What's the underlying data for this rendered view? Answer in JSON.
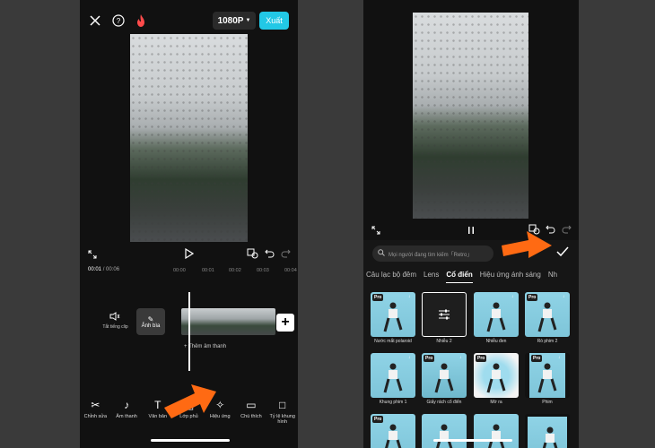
{
  "left": {
    "resolution": "1080P",
    "export_label": "Xuất",
    "time_current": "00:01",
    "time_total": "00:06",
    "ticks": [
      "00:00",
      "00:01",
      "00:02",
      "00:03",
      "00:04"
    ],
    "mute_label": "Tắt tiếng clip",
    "cover_label": "Ảnh bìa",
    "add_audio": "+ Thêm âm thanh",
    "tools": [
      {
        "icon": "scissors-icon",
        "label": "Chỉnh sửa"
      },
      {
        "icon": "music-note-icon",
        "label": "Âm thanh"
      },
      {
        "icon": "text-icon",
        "label": "Văn bản"
      },
      {
        "icon": "overlay-icon",
        "label": "Lớp phủ"
      },
      {
        "icon": "sparkle-icon",
        "label": "Hiệu ứng"
      },
      {
        "icon": "caption-icon",
        "label": "Chú thích"
      },
      {
        "icon": "aspect-ratio-icon",
        "label": "Tỷ lệ khung hình"
      }
    ]
  },
  "right": {
    "search_placeholder": "Mọi người đang tìm kiếm「Retro」",
    "tabs": [
      {
        "label": "Câu lạc bộ đêm",
        "active": false
      },
      {
        "label": "Lens",
        "active": false
      },
      {
        "label": "Cổ điển",
        "active": true
      },
      {
        "label": "Hiệu ứng ánh sáng",
        "active": false
      },
      {
        "label": "Nh",
        "active": false
      }
    ],
    "effects": [
      {
        "label": "Nước mắt polaroid",
        "pro": "Pro"
      },
      {
        "label": "Nhiễu 2",
        "pro": ""
      },
      {
        "label": "Nhiễu đen",
        "pro": ""
      },
      {
        "label": "Rò phim 2",
        "pro": "Pro"
      },
      {
        "label": "Khung phim 1",
        "pro": ""
      },
      {
        "label": "Giấy rách cổ điển",
        "pro": "Pro"
      },
      {
        "label": "Mờ ra",
        "pro": "Pro"
      },
      {
        "label": "Phim",
        "pro": "Pro"
      },
      {
        "label": "",
        "pro": "Pro"
      },
      {
        "label": "",
        "pro": ""
      },
      {
        "label": "",
        "pro": ""
      },
      {
        "label": "",
        "pro": ""
      }
    ]
  }
}
